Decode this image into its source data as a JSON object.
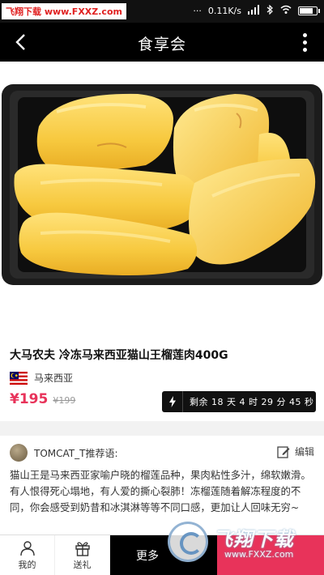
{
  "status_bar": {
    "watermark_logo": "飞翔下载",
    "watermark_url": "www.FXXZ.com",
    "network_speed": "0.11K/s",
    "signal_icon": "signal-icon",
    "wifi_icon": "wifi-icon",
    "battery_icon": "battery-icon"
  },
  "header": {
    "title": "食享会",
    "back_icon": "back-icon",
    "more_icon": "more-vertical-icon"
  },
  "product": {
    "name": "大马农夫 冷冻马来西亚猫山王榴莲肉400G",
    "origin": "马来西亚",
    "flag_icon": "malaysia-flag-icon",
    "price": "¥195",
    "original_price": "¥199",
    "countdown_text": "剩余 18 天 4 时 29 分 45 秒",
    "countdown_icon": "lightning-icon"
  },
  "recommendation": {
    "user_label": "TOMCAT_T推荐语:",
    "edit_label": "编辑",
    "edit_icon": "edit-icon",
    "text": "猫山王是马来西亚家喻户晓的榴莲品种，果肉粘性多汁，绵软嫩滑。有人恨得死心塌地，有人爱的撕心裂肺！冻榴莲随着解冻程度的不同，你会感受到奶昔和冰淇淋等等不同口感，更加让人回味无穷~"
  },
  "bottom_bar": {
    "mine_label": "我的",
    "mine_icon": "user-icon",
    "gift_label": "送礼",
    "gift_icon": "gift-icon",
    "more_label": "更多",
    "accent_color": "#e8335a"
  },
  "corner_watermark": {
    "brand": "飞翔下载",
    "url": "www.FXXZ.com"
  }
}
